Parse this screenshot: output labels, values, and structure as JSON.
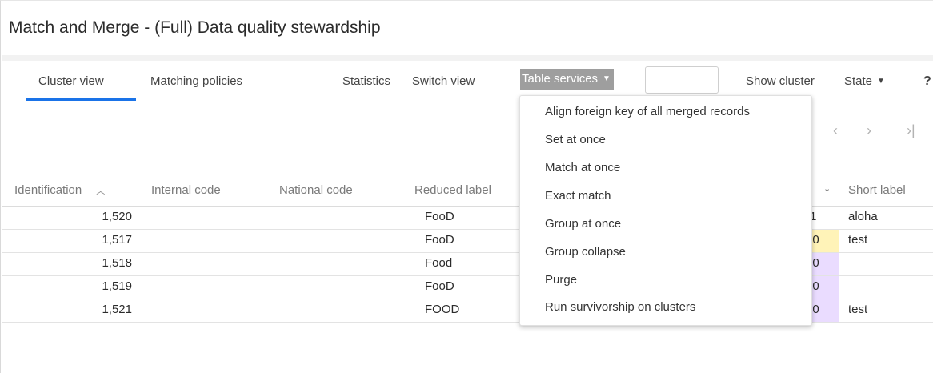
{
  "page": {
    "title": "Match and Merge - (Full) Data quality stewardship"
  },
  "tabs": {
    "cluster_view": "Cluster view",
    "matching_policies": "Matching policies"
  },
  "toolbar": {
    "statistics": "Statistics",
    "switch_view": "Switch view",
    "table_services": "Table services",
    "show_cluster": "Show cluster",
    "state": "State",
    "help": "?",
    "input_value": ""
  },
  "pager": {
    "prev": "‹",
    "next": "›",
    "last": "›|"
  },
  "columns": {
    "identification": "Identification",
    "internal_code": "Internal code",
    "national_code": "National code",
    "reduced_label": "Reduced label",
    "short_label": "Short label"
  },
  "rows": [
    {
      "id": "1,520",
      "reduced_label": "FooD",
      "partial": "-1",
      "short_label": "aloha"
    },
    {
      "id": "1,517",
      "reduced_label": "FooD",
      "partial": "00",
      "short_label": "test"
    },
    {
      "id": "1,518",
      "reduced_label": "Food",
      "partial": "00",
      "short_label": ""
    },
    {
      "id": "1,519",
      "reduced_label": "FooD",
      "partial": "00",
      "short_label": ""
    },
    {
      "id": "1,521",
      "reduced_label": "FOOD",
      "partial": "00",
      "short_label": "test"
    }
  ],
  "menu": {
    "items": [
      "Align foreign key of all merged records",
      "Set at once",
      "Match at once",
      "Exact match",
      "Group at once",
      "Group collapse",
      "Purge",
      "Run survivorship on clusters"
    ]
  },
  "colors": {
    "accent": "#1a73e8",
    "dropdown_bg": "#9e9e9e",
    "partial_white": "#ffffff",
    "partial_yellow": "#fff3b8",
    "partial_purple": "#eadcff"
  },
  "icons": {
    "sort_asc": "chevron-up-icon",
    "dropdown": "caret-down-icon",
    "help": "help-icon"
  }
}
